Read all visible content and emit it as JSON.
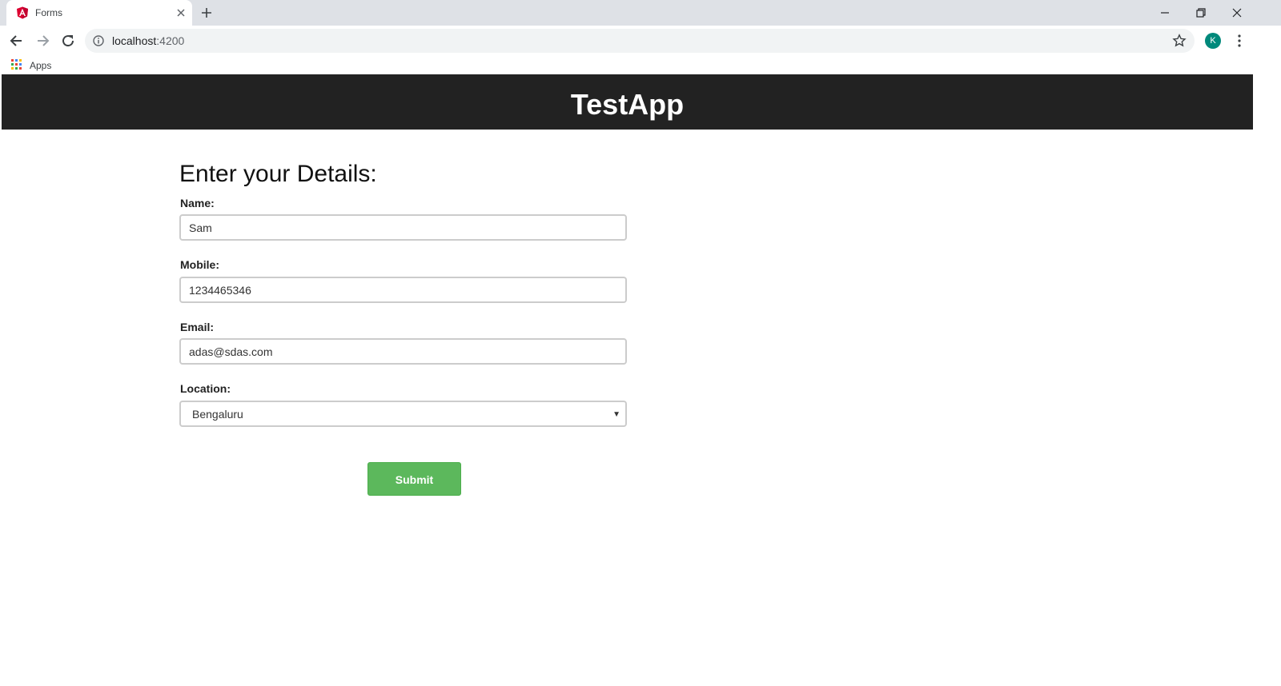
{
  "browser": {
    "tab_title": "Forms",
    "url_host": "localhost",
    "url_port": ":4200",
    "avatar_letter": "K",
    "bookmarks_apps": "Apps"
  },
  "app": {
    "title": "TestApp"
  },
  "form": {
    "heading": "Enter your Details:",
    "name_label": "Name:",
    "name_value": "Sam",
    "mobile_label": "Mobile:",
    "mobile_value": "1234465346",
    "email_label": "Email:",
    "email_value": "adas@sdas.com",
    "location_label": "Location:",
    "location_value": "Bengaluru",
    "submit_label": "Submit"
  },
  "colors": {
    "header_bg": "#222222",
    "submit_bg": "#5cb85c",
    "avatar_bg": "#00897b"
  }
}
